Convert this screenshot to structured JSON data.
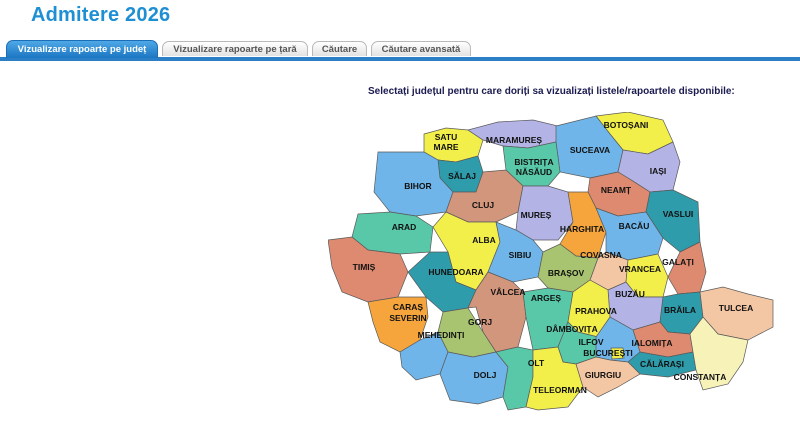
{
  "header": {
    "title": "Admitere 2026"
  },
  "tabs": [
    {
      "label": "Vizualizare rapoarte pe județ",
      "active": true
    },
    {
      "label": "Vizualizare rapoarte pe țară",
      "active": false
    },
    {
      "label": "Căutare",
      "active": false
    },
    {
      "label": "Căutare avansată",
      "active": false
    }
  ],
  "main": {
    "prompt": "Selectați județul pentru care doriți sa vizualizați listele/rapoartele disponibile:"
  },
  "map": {
    "labels": {
      "satu_mare": "SATU",
      "satu_mare2": "MARE",
      "maramures": "MARAMUREȘ",
      "botosani": "BOTOȘANI",
      "bistrita": "BISTRIȚA",
      "bistrita2": "NĂSĂUD",
      "suceava": "SUCEAVA",
      "salaj": "SĂLAJ",
      "iasi": "IAȘI",
      "bihor": "BIHOR",
      "neamt": "NEAMȚ",
      "cluj": "CLUJ",
      "mures": "MUREȘ",
      "vaslui": "VASLUI",
      "arad": "ARAD",
      "harghita": "HARGHITA",
      "bacau": "BACĂU",
      "alba": "ALBA",
      "covasna": "COVASNA",
      "sibiu": "SIBIU",
      "galati": "GALAȚI",
      "timis": "TIMIȘ",
      "hunedoara": "HUNEDOARA",
      "brasov": "BRAȘOV",
      "vrancea": "VRANCEA",
      "caras": "CARAȘ",
      "caras2": "SEVERIN",
      "valcea": "VÂLCEA",
      "arges": "ARGEȘ",
      "buzau": "BUZĂU",
      "prahova": "PRAHOVA",
      "braila": "BRĂILA",
      "tulcea": "TULCEA",
      "gorj": "GORJ",
      "mehedinti": "MEHEDINȚI",
      "dambovita": "DÂMBOVIȚA",
      "ilfov": "ILFOV",
      "ialomita": "IALOMIȚA",
      "bucuresti": "BUCUREȘTI",
      "calarasi": "CĂLĂRAȘI",
      "olt": "OLT",
      "dolj": "DOLJ",
      "giurgiu": "GIURGIU",
      "constanta": "CONSTANȚA",
      "teleorman": "TELEORMAN"
    }
  },
  "colors": {
    "accent": "#1e8fd3",
    "tab_active": "#1b76c2",
    "tab_line": "#2a7fc6"
  }
}
